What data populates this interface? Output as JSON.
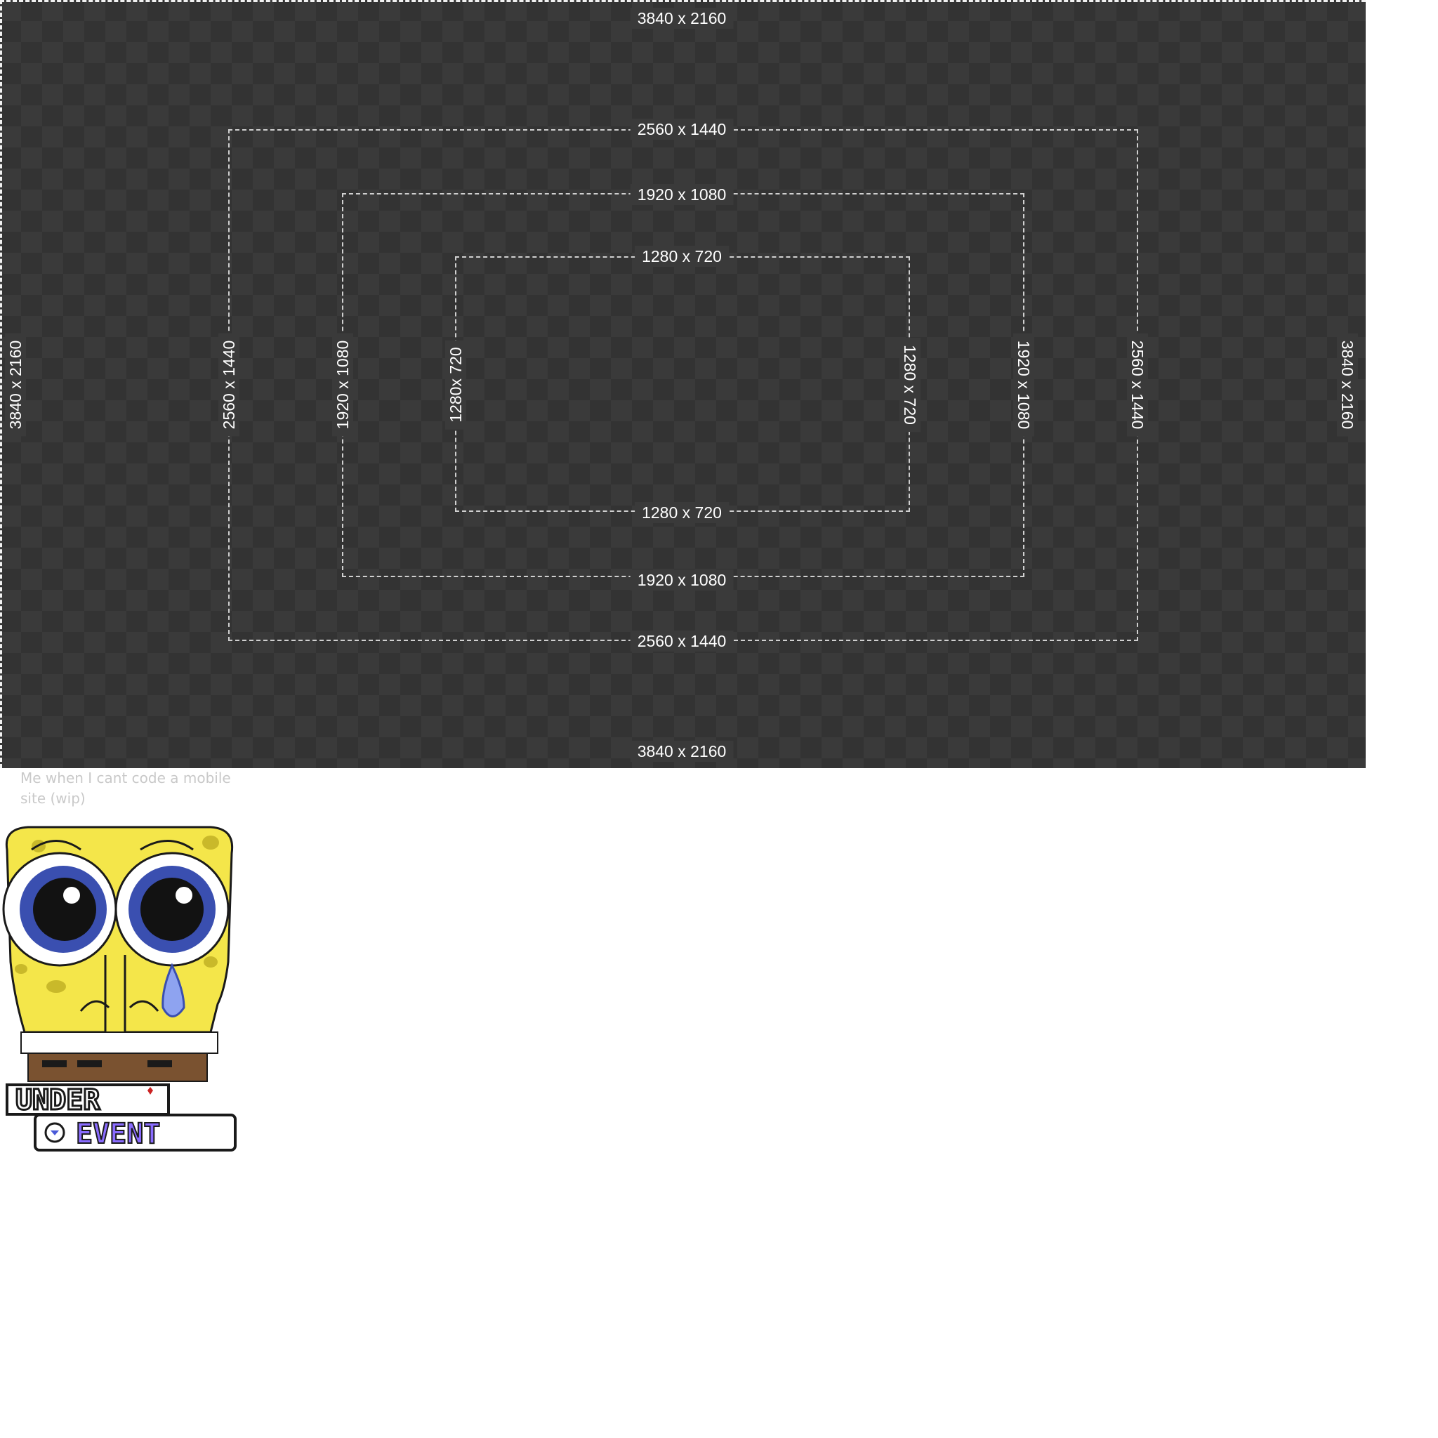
{
  "guide": {
    "outer_label": "3840 x 2160",
    "r2560_label": "2560 x 1440",
    "r1920_label": "1920 x 1080",
    "r1280_label": "1280 x 720",
    "r1280_left_label": "1280x 720",
    "colors": {
      "background": "#3a3a3a",
      "checker": "#333333",
      "dash": "#d0d0d0",
      "text": "#ffffff"
    }
  },
  "caption": {
    "text": "Me when I cant code a mobile site (wip)"
  },
  "logo": {
    "line1": "UNDER",
    "line2": "EVENT",
    "accent": "#8a6cff"
  }
}
